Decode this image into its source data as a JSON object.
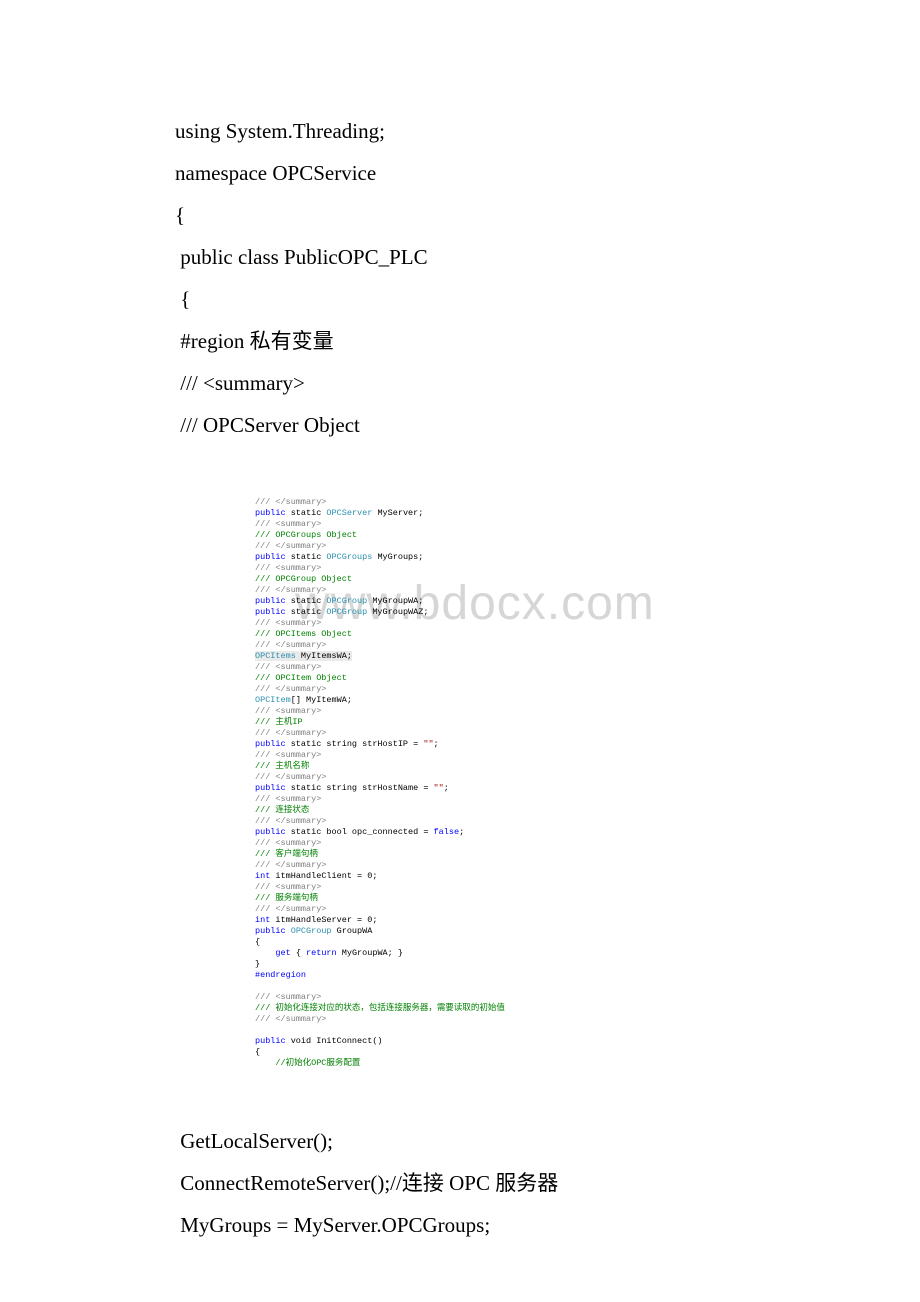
{
  "top_code": {
    "l1": "using System.Threading;",
    "l2": "namespace OPCService",
    "l3": "{",
    "l4": " public class PublicOPC_PLC",
    "l5": " {",
    "l6": " #region 私有变量",
    "l7": " /// <summary>",
    "l8": " /// OPCServer Object"
  },
  "watermark": "www.bdocx.com",
  "inner": {
    "l01a": "/// </summary>",
    "l02a": "public",
    "l02b": " static ",
    "l02c": "OPCServer",
    "l02d": " MyServer;",
    "l03a": "/// <summary>",
    "l04a": "/// OPCGroups Object",
    "l05a": "/// </summary>",
    "l06a": "public",
    "l06b": " static ",
    "l06c": "OPCGroups",
    "l06d": " MyGroups;",
    "l07a": "/// <summary>",
    "l08a": "/// OPCGroup Object",
    "l09a": "/// </summary>",
    "l10a": "public",
    "l10b": " static ",
    "l10c": "OPCGroup",
    "l10d": " MyGroupWA;",
    "l11a": "public",
    "l11b": " static ",
    "l11c": "OPCGroup",
    "l11d": " MyGroupWAZ;",
    "l12a": "/// <summary>",
    "l13a": "/// OPCItems Object",
    "l14a": "/// </summary>",
    "l15a": "OPCItems",
    "l15b": " MyItemsWA;",
    "l16a": "/// <summary>",
    "l17a": "/// OPCItem Object",
    "l18a": "/// </summary>",
    "l19a": "OPCItem",
    "l19b": "[] MyItemWA;",
    "l20a": "/// <summary>",
    "l21a": "/// 主机IP",
    "l22a": "/// </summary>",
    "l23a": "public",
    "l23b": " static string strHostIP = ",
    "l23c": "\"\"",
    "l23d": ";",
    "l24a": "/// <summary>",
    "l25a": "/// 主机名称",
    "l26a": "/// </summary>",
    "l27a": "public",
    "l27b": " static string strHostName = ",
    "l27c": "\"\"",
    "l27d": ";",
    "l28a": "/// <summary>",
    "l29a": "/// 连接状态",
    "l30a": "/// </summary>",
    "l31a": "public",
    "l31b": " static bool opc_connected = ",
    "l31c": "false",
    "l31d": ";",
    "l32a": "/// <summary>",
    "l33a": "/// 客户端句柄",
    "l34a": "/// </summary>",
    "l35a": "int",
    "l35b": " itmHandleClient = 0;",
    "l36a": "/// <summary>",
    "l37a": "/// 服务端句柄",
    "l38a": "/// </summary>",
    "l39a": "int",
    "l39b": " itmHandleServer = 0;",
    "l40a": "public",
    "l40b": " ",
    "l40c": "OPCGroup",
    "l40d": " GroupWA",
    "l41a": "{",
    "l42a": "    get",
    "l42b": " { ",
    "l42c": "return",
    "l42d": " MyGroupWA; }",
    "l43a": "}",
    "l44a": "#endregion",
    "l45blank": "",
    "l46a": "/// <summary>",
    "l47a": "/// 初始化连接对应的状态，包括连接服务器，需要读取的初始值",
    "l48a": "/// </summary>",
    "l49blank": "",
    "l50a": "public",
    "l50b": " void InitConnect()",
    "l51a": "{",
    "l52a": "    //初始化OPC服务配置"
  },
  "bottom_code": {
    "l1": " GetLocalServer();",
    "l2": " ConnectRemoteServer();//连接 OPC 服务器",
    "l3": " MyGroups = MyServer.OPCGroups;"
  }
}
